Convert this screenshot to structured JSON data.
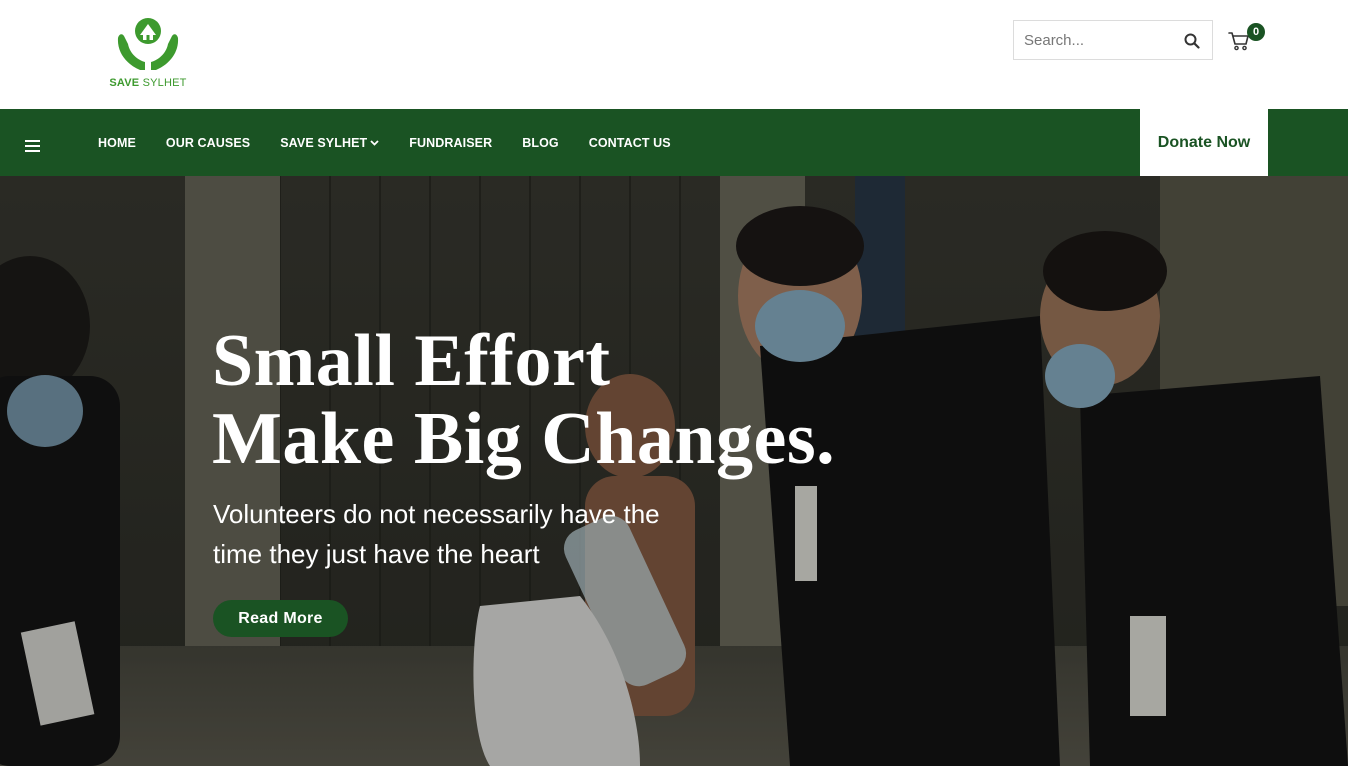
{
  "brand": {
    "name_bold": "SAVE",
    "name_light": "SYLHET",
    "color": "#3d9a2e"
  },
  "search": {
    "placeholder": "Search..."
  },
  "cart": {
    "count": "0"
  },
  "nav": {
    "items": [
      {
        "label": "HOME"
      },
      {
        "label": "OUR CAUSES"
      },
      {
        "label": "SAVE SYLHET"
      },
      {
        "label": "FUNDRAISER"
      },
      {
        "label": "BLOG"
      },
      {
        "label": "CONTACT US"
      }
    ],
    "donate_label": "Donate Now",
    "color": "#1a5323"
  },
  "hero": {
    "headline_line1": "Small Effort",
    "headline_line2": "Make Big Changes.",
    "subtext_line1": "Volunteers do not necessarily have the",
    "subtext_line2": "time they just have the heart",
    "button_label": "Read More"
  },
  "icons": {
    "menu": "hamburger-icon",
    "search": "search-icon",
    "cart": "cart-icon",
    "dropdown": "chevron-down-icon"
  }
}
